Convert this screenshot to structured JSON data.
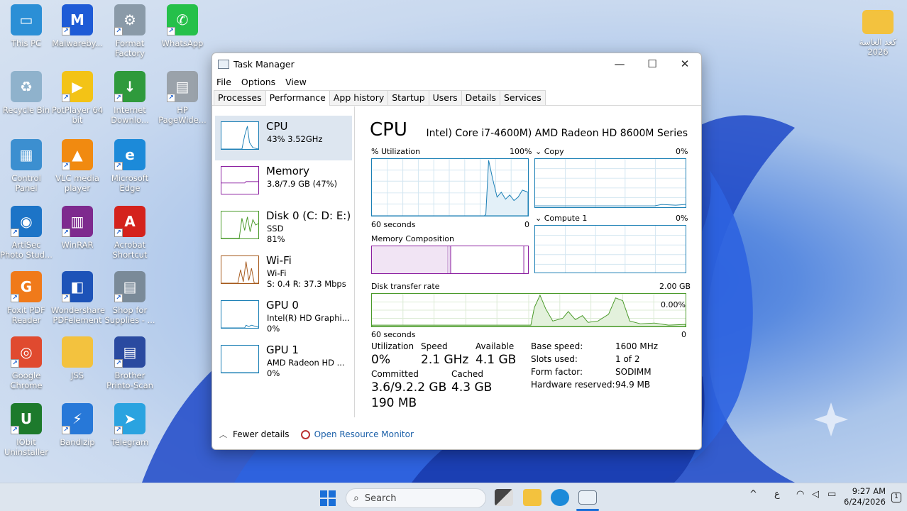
{
  "desktop": {
    "icons": [
      {
        "label": "This PC",
        "color": "#2b8fd6",
        "glyph": "▭"
      },
      {
        "label": "Malwareby...",
        "color": "#1e5bd6",
        "glyph": "M"
      },
      {
        "label": "Format Factory",
        "color": "#8a9aa8",
        "glyph": "⚙"
      },
      {
        "label": "WhatsApp",
        "color": "#25c04a",
        "glyph": "✆"
      },
      {
        "label": "Recycle Bin",
        "color": "#8fb2cc",
        "glyph": "♻"
      },
      {
        "label": "PotPlayer 64 bit",
        "color": "#f3c316",
        "glyph": "▶"
      },
      {
        "label": "Internet Downlo...",
        "color": "#2f9a3c",
        "glyph": "↓"
      },
      {
        "label": "HP PageWide...",
        "color": "#9aa2aa",
        "glyph": "▤"
      },
      {
        "label": "Control Panel",
        "color": "#3c8fd0",
        "glyph": "▦"
      },
      {
        "label": "VLC media player",
        "color": "#f18a10",
        "glyph": "▲"
      },
      {
        "label": "Microsoft Edge",
        "color": "#1c8ad9",
        "glyph": "e"
      },
      {
        "label": "ArtiSec Photo Stud...",
        "color": "#1c74c7",
        "glyph": "◉"
      },
      {
        "label": "WinRAR",
        "color": "#7e2a8e",
        "glyph": "▥"
      },
      {
        "label": "Acrobat Shortcut",
        "color": "#d4221c",
        "glyph": "A"
      },
      {
        "label": "Foxit PDF Reader",
        "color": "#f07a1a",
        "glyph": "G"
      },
      {
        "label": "Wondershare PDFelement",
        "color": "#1d53b8",
        "glyph": "◧"
      },
      {
        "label": "Shop for Supplies - ...",
        "color": "#7a8a98",
        "glyph": "▤"
      },
      {
        "label": "Google Chrome",
        "color": "#e04a2f",
        "glyph": "◎"
      },
      {
        "label": "JSS",
        "color": "#f3c23e",
        "glyph": ""
      },
      {
        "label": "Brother Printo-Scan",
        "color": "#2a4aa0",
        "glyph": "▤"
      },
      {
        "label": "IObit Uninstaller",
        "color": "#1d7a2c",
        "glyph": "U"
      },
      {
        "label": "Bandizip",
        "color": "#2778d8",
        "glyph": "⚡"
      },
      {
        "label": "Telegram",
        "color": "#2aa3e0",
        "glyph": "➤"
      }
    ],
    "folder_right": {
      "label": "كعد العاسة 2026",
      "color": "#f3c23e"
    }
  },
  "window": {
    "title": "Task Manager",
    "controls": {
      "minimize": "—",
      "maximize": "☐",
      "close": "✕"
    },
    "menu": [
      "File",
      "Options",
      "View"
    ],
    "tabs": [
      "Processes",
      "Performance",
      "App history",
      "Startup",
      "Users",
      "Details",
      "Services"
    ],
    "active_tab": "Performance"
  },
  "sidebar": {
    "items": [
      {
        "title": "CPU",
        "line1": "43%  3.52GHz",
        "line2": "",
        "color": "#1b7fb5"
      },
      {
        "title": "Memory",
        "line1": "3.8/7.9 GB (47%)",
        "line2": "",
        "color": "#8b1fa0"
      },
      {
        "title": "Disk 0 (C: D: E:)",
        "line1": "SSD",
        "line2": "81%",
        "color": "#4a9a2a"
      },
      {
        "title": "Wi-Fi",
        "line1": "Wi-Fi",
        "line2": "S: 0.4  R: 37.3 Mbps",
        "color": "#a5581a"
      },
      {
        "title": "GPU 0",
        "line1": "Intel(R) HD Graphi...",
        "line2": "0%",
        "color": "#1b7fb5"
      },
      {
        "title": "GPU 1",
        "line1": "AMD Radeon HD ...",
        "line2": "0%",
        "color": "#1b7fb5"
      }
    ]
  },
  "main": {
    "heading": "CPU",
    "processor": "Intel) Core i7-4600M) AMD Radeon HD 8600M Series",
    "util_label": "% Utilization",
    "util_max": "100%",
    "seconds_label": "60 seconds",
    "zero": "0",
    "copy_label": "Copy",
    "copy_pct": "0%",
    "compute_label": "Compute 1",
    "compute_pct": "0%",
    "memcomp_label": "Memory Composition",
    "disk_label": "Disk transfer rate",
    "disk_max": "2.00 GB",
    "disk_pct": "0.00%",
    "stats": {
      "utilization_label": "Utilization",
      "utilization": "0%",
      "speed_label": "Speed",
      "speed": "2.1 GHz",
      "available_label": "Available",
      "available": "4.1 GB",
      "committed_label": "Committed",
      "committed": "3.6/9.2.2 GB",
      "cached_label": "Cached",
      "cached": "4.3 GB",
      "extra": "190 MB"
    },
    "details": [
      {
        "k": "Base speed:",
        "v": "1600 MHz"
      },
      {
        "k": "Slots used:",
        "v": "1 of 2"
      },
      {
        "k": "Form factor:",
        "v": "SODIMM"
      },
      {
        "k": "Hardware reserved:",
        "v": "94.9 MB"
      }
    ]
  },
  "footer": {
    "fewer_details": "Fewer details",
    "open_resource_monitor": "Open Resource Monitor"
  },
  "taskbar": {
    "search_placeholder": "Search",
    "tray_chevron": "^",
    "tray_lang": "ع",
    "time": "9:27 AM",
    "date": "6/24/2026"
  }
}
